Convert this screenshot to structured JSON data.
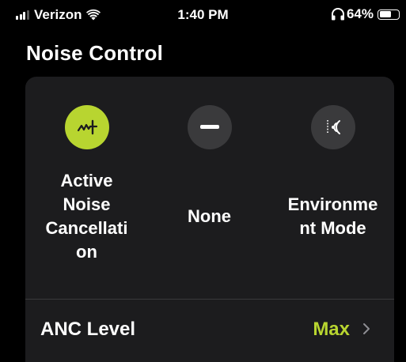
{
  "status_bar": {
    "carrier": "Verizon",
    "time": "1:40 PM",
    "battery_percent": "64%",
    "battery_level": 0.64,
    "icons": [
      "signal-icon",
      "wifi-icon",
      "headphones-icon",
      "battery-icon"
    ]
  },
  "page": {
    "title": "Noise Control"
  },
  "modes": [
    {
      "label": "Active Noise Cancellation",
      "lines": [
        "Active",
        "Noise",
        "Cancellati",
        "on"
      ],
      "icon": "anc-waveform-icon",
      "selected": true
    },
    {
      "label": "None",
      "lines": [
        "None"
      ],
      "icon": "minus-icon",
      "selected": false
    },
    {
      "label": "Environment Mode",
      "lines": [
        "Environme",
        "nt Mode"
      ],
      "icon": "environment-sound-icon",
      "selected": false
    }
  ],
  "anc": {
    "label": "ANC Level",
    "value": "Max"
  },
  "colors": {
    "accent": "#b8d530",
    "background": "#000000",
    "card": "#1c1c1e",
    "inactive_circle": "#3a3a3c"
  }
}
